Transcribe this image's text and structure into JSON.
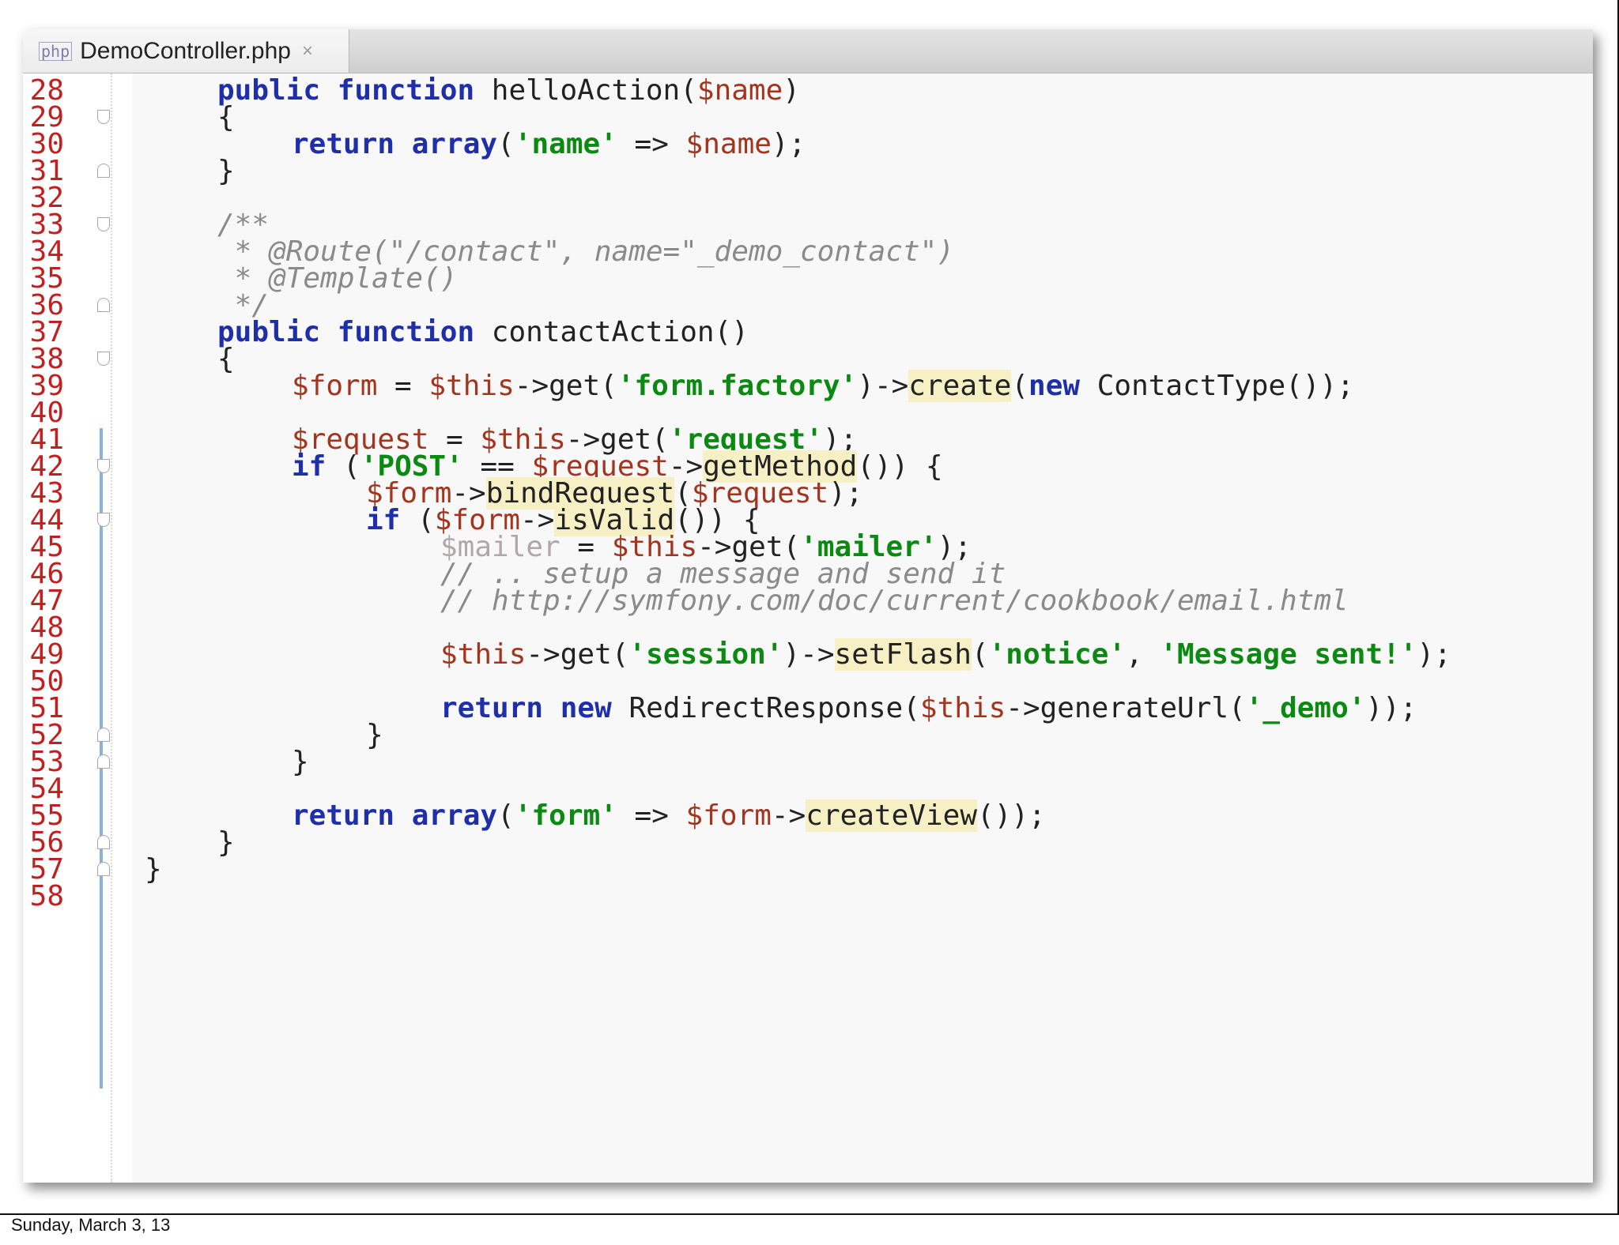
{
  "tab": {
    "icon": "php-file-icon",
    "filename": "DemoController.php",
    "close": "×"
  },
  "footer": {
    "date": "Sunday, March 3, 13"
  },
  "lines": [
    {
      "n": "28",
      "tokens": [
        [
          "kw",
          "public"
        ],
        [
          "",
          ""
        ],
        [
          "",
          ""
        ]
      ]
    }
  ],
  "code": {
    "l28": "28",
    "l29": "29",
    "l30": "30",
    "l31": "31",
    "l32": "32",
    "l33": "33",
    "l34": "34",
    "l35": "35",
    "l36": "36",
    "l37": "37",
    "l38": "38",
    "l39": "39",
    "l40": "40",
    "l41": "41",
    "l42": "42",
    "l43": "43",
    "l44": "44",
    "l45": "45",
    "l46": "46",
    "l47": "47",
    "l48": "48",
    "l49": "49",
    "l50": "50",
    "l51": "51",
    "l52": "52",
    "l53": "53",
    "l54": "54",
    "l55": "55",
    "l56": "56",
    "l57": "57",
    "l58": "58",
    "t_public": "public",
    "t_function": "function",
    "t_helloAction": " helloAction(",
    "t_name_var": "$name",
    "t_close_paren": ")",
    "t_open_brace": "{",
    "t_close_brace": "}",
    "t_return": "return",
    "t_array": "array",
    "t_paren_open": "(",
    "t_name_str": "'name'",
    "t_arrow": " => ",
    "t_paren_semicolon": ");",
    "t_doc_open": "/**",
    "t_doc_route": " * @Route(\"/contact\", name=\"_demo_contact\")",
    "t_doc_template": " * @Template()",
    "t_doc_close": " */",
    "t_contactAction": " contactAction()",
    "t_form_var": "$form",
    "t_eq": " = ",
    "t_this": "$this",
    "t_get_open": "->get(",
    "t_form_factory": "'form.factory'",
    "t_close_arrow": ")->",
    "t_create": "create",
    "t_new": "new",
    "t_contactType": " ContactType());",
    "t_request_var": "$request",
    "t_request_str": "'request'",
    "t_if": "if",
    "t_space_paren": " (",
    "t_post_str": "'POST'",
    "t_eqeq": " == ",
    "t_arrow_sym": "->",
    "t_getMethod": "getMethod",
    "t_paren_brace": "()) {",
    "t_bindRequest": "bindRequest",
    "t_isValid": "isValid",
    "t_mailer_var": "$mailer",
    "t_mailer_str": "'mailer'",
    "t_comment_setup": "// .. setup a message and send it",
    "t_comment_url": "// http://symfony.com/doc/current/cookbook/email.html",
    "t_session_str": "'session'",
    "t_setFlash": "setFlash",
    "t_notice_str": "'notice'",
    "t_comma": ", ",
    "t_message_str": "'Message sent!'",
    "t_redirect": " RedirectResponse(",
    "t_generateUrl": "->generateUrl(",
    "t_demo_str": "'_demo'",
    "t_double_close": "));",
    "t_form_str": "'form'",
    "t_createView": "createView",
    "t_view_close": "());",
    "t_single_paren": ")",
    "t_semicolon_close": "));",
    "t_space": " "
  }
}
